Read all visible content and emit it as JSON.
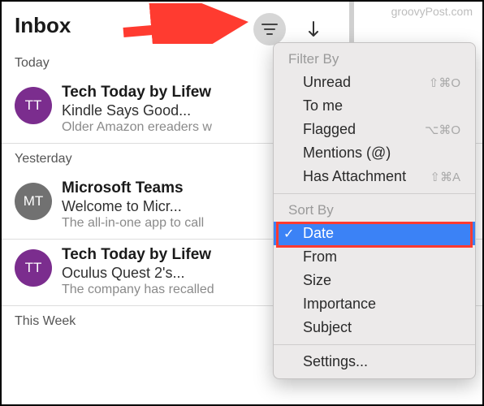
{
  "watermark": "groovyPost.com",
  "header": {
    "title": "Inbox"
  },
  "sections": {
    "today": "Today",
    "yesterday": "Yesterday",
    "thisweek": "This Week"
  },
  "emails": [
    {
      "avatar": "TT",
      "sender": "Tech Today by Lifew",
      "subject": "Kindle Says Good...",
      "preview": "Older Amazon ereaders w"
    },
    {
      "avatar": "MT",
      "sender": "Microsoft Teams",
      "subject": "Welcome to Micr...",
      "preview": "The all-in-one app to call"
    },
    {
      "avatar": "TT",
      "sender": "Tech Today by Lifew",
      "subject": "Oculus Quest 2's...",
      "preview": "The company has recalled"
    }
  ],
  "menu": {
    "filter_label": "Filter By",
    "filter_items": {
      "unread": {
        "label": "Unread",
        "shortcut": "⇧⌘O"
      },
      "tome": {
        "label": "To me"
      },
      "flagged": {
        "label": "Flagged",
        "shortcut": "⌥⌘O"
      },
      "mentions": {
        "label": "Mentions (@)"
      },
      "attachment": {
        "label": "Has Attachment",
        "shortcut": "⇧⌘A"
      }
    },
    "sort_label": "Sort By",
    "sort_items": {
      "date": "Date",
      "from": "From",
      "size": "Size",
      "importance": "Importance",
      "subject": "Subject"
    },
    "settings": "Settings..."
  }
}
